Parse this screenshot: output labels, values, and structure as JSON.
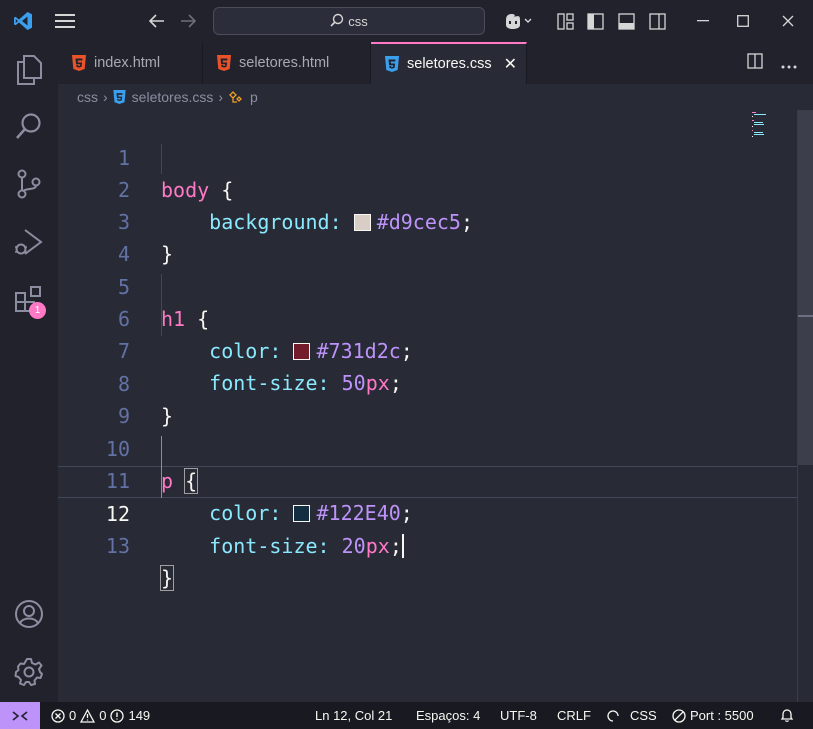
{
  "titlebar": {
    "search_text": "css",
    "icons": [
      "vscode-logo-icon",
      "menu-icon",
      "back-icon",
      "forward-icon",
      "copilot-icon",
      "layout-icon",
      "toggle-primary-sidebar-icon",
      "toggle-panel-icon",
      "toggle-secondary-sidebar-icon",
      "minimize-icon",
      "maximize-icon",
      "close-icon"
    ]
  },
  "activity": {
    "extensions_badge": "1"
  },
  "tabs": [
    {
      "label": "index.html",
      "icon": "html-file-icon",
      "active": false
    },
    {
      "label": "seletores.html",
      "icon": "html-file-icon",
      "active": false
    },
    {
      "label": "seletores.css",
      "icon": "css-file-icon",
      "active": true
    }
  ],
  "breadcrumb": {
    "folder": "css",
    "file": "seletores.css",
    "symbol": "p"
  },
  "editor": {
    "lines": [
      {
        "n": "1"
      },
      {
        "n": "2"
      },
      {
        "n": "3"
      },
      {
        "n": "4"
      },
      {
        "n": "5"
      },
      {
        "n": "6"
      },
      {
        "n": "7"
      },
      {
        "n": "8"
      },
      {
        "n": "9"
      },
      {
        "n": "10"
      },
      {
        "n": "11"
      },
      {
        "n": "12"
      },
      {
        "n": "13"
      }
    ],
    "code": {
      "l1_sel": "body",
      "l2_prop": "background",
      "l2_val": "#d9cec5",
      "l5_sel": "h1",
      "l6_prop": "color",
      "l6_val": "#731d2c",
      "l7_prop": "font-size",
      "l7_num": "50",
      "l7_unit": "px",
      "l10_sel": "p",
      "l11_prop": "color",
      "l11_val": "#122E40",
      "l12_prop": "font-size",
      "l12_num": "20",
      "l12_unit": "px"
    },
    "swatch_colors": [
      "#d9cec5",
      "#731d2c",
      "#122E40"
    ],
    "current_line": "12"
  },
  "statusbar": {
    "errors": "0",
    "warnings": "0",
    "info": "149",
    "position": "Ln 12, Col 21",
    "spaces": "Espaços: 4",
    "encoding": "UTF-8",
    "eol": "CRLF",
    "language": "CSS",
    "port": "Port : 5500"
  },
  "colors": {
    "accent": "#ff79c6",
    "remote": "#bd93f9",
    "background": "#282a36"
  }
}
